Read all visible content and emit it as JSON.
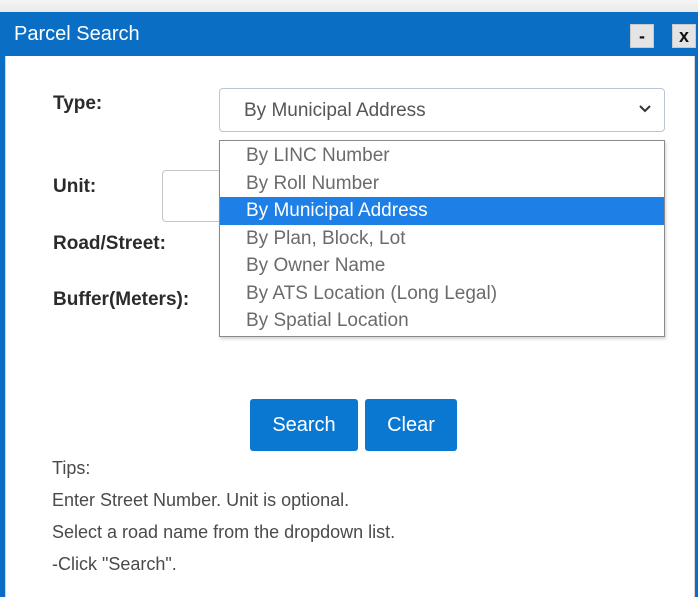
{
  "window": {
    "title": "Parcel Search",
    "minimize_label": "-",
    "close_label": "x"
  },
  "form": {
    "type_label": "Type:",
    "type_selected": "By Municipal Address",
    "unit_label": "Unit:",
    "unit_value": "",
    "road_label": "Road/Street:",
    "buffer_label": "Buffer(Meters):"
  },
  "dropdown": {
    "options": [
      "By LINC Number",
      "By Roll Number",
      "By Municipal Address",
      "By Plan, Block, Lot",
      "By Owner Name",
      "By ATS Location (Long Legal)",
      "By Spatial Location"
    ],
    "highlighted": "By Municipal Address"
  },
  "buttons": {
    "search": "Search",
    "clear": "Clear"
  },
  "tips": {
    "heading": "Tips:",
    "lines": [
      "Enter Street Number. Unit is optional.",
      "Select a road name from the dropdown list.",
      "-Click \"Search\"."
    ]
  },
  "colors": {
    "titlebar": "#0a6fc4",
    "button": "#0a78d1",
    "highlight": "#1e7fe6"
  },
  "icons": {
    "dropdown": "chevron-down-icon"
  }
}
